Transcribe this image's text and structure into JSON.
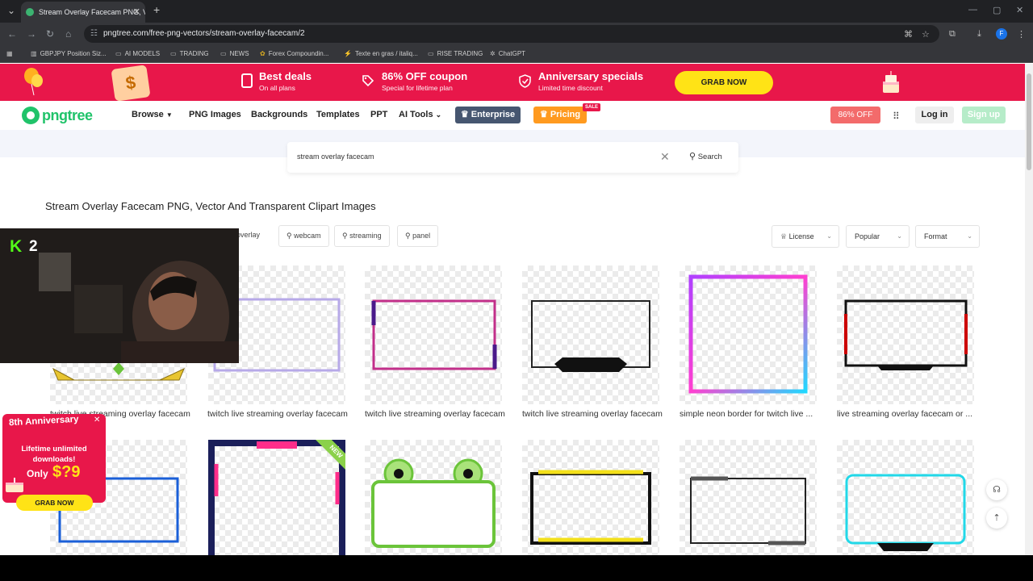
{
  "browser": {
    "tab_title": "Stream Overlay Facecam PNG, V",
    "url": "pngtree.com/free-png-vectors/stream-overlay-facecam/2",
    "profile_initial": "F",
    "bookmarks": [
      "GBPJPY Position Siz...",
      "AI MODELS",
      "TRADING",
      "NEWS",
      "Forex Compoundin...",
      "Texte en gras / italiq...",
      "RISE TRADING",
      "ChatGPT"
    ]
  },
  "promo": {
    "items": [
      {
        "title": "Best deals",
        "sub": "On all plans"
      },
      {
        "title": "86% OFF coupon",
        "sub": "Special for lifetime plan"
      },
      {
        "title": "Anniversary specials",
        "sub": "Limited time discount"
      }
    ],
    "grab_now": "GRAB NOW",
    "gift_glyph": "$"
  },
  "header": {
    "logo": "pngtree",
    "nav": [
      "Browse",
      "PNG Images",
      "Backgrounds",
      "Templates",
      "PPT",
      "AI Tools"
    ],
    "enterprise": "Enterprise",
    "pricing": "Pricing",
    "sale_badge": "SALE",
    "off_badge": "86% OFF",
    "login": "Log in",
    "signup": "Sign up"
  },
  "search": {
    "query": "stream overlay facecam",
    "button": "Search"
  },
  "page_title": "Stream Overlay Facecam PNG, Vector And Transparent Clipart Images",
  "chips": [
    "overlay",
    "webcam",
    "streaming",
    "panel"
  ],
  "filters": {
    "license": "License",
    "sort": "Popular",
    "format": "Format"
  },
  "cards_row1": [
    "twitch live streaming overlay facecam",
    "twitch live streaming overlay facecam",
    "twitch live streaming overlay facecam",
    "twitch live streaming overlay facecam",
    "simple neon border for twitch live ...",
    "live streaming overlay facecam or ..."
  ],
  "webcam": {
    "channel_badge": "K",
    "channel_number": "2"
  },
  "anniversary_popup": {
    "heading": "8th Anniversary",
    "line1": "Lifetime unlimited",
    "line2": "downloads!",
    "only": "Only",
    "price": "$?9",
    "cta": "GRAB NOW"
  },
  "new_badge": "NEW",
  "colors": {
    "brand_red": "#e8174a",
    "brand_green": "#20c36a",
    "cta_yellow": "#ffe316"
  }
}
